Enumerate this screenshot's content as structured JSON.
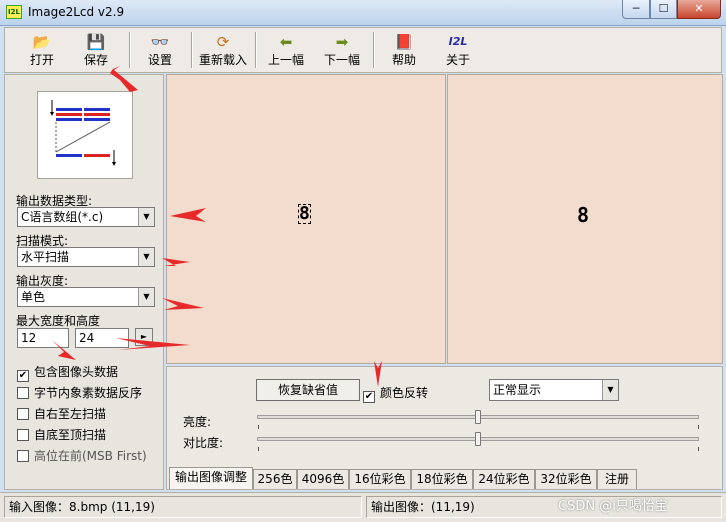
{
  "window": {
    "title": "Image2Lcd v2.9",
    "app_icon_text": "I2L",
    "minimize": "─",
    "maximize": "☐",
    "close": "✕"
  },
  "toolbar": {
    "buttons": [
      {
        "label": "打开",
        "icon": "open-folder-icon",
        "glyph": "📂"
      },
      {
        "label": "保存",
        "icon": "floppy-save-icon",
        "glyph": "💾"
      },
      {
        "label": "设置",
        "icon": "glasses-settings-icon",
        "glyph": "👓"
      },
      {
        "label": "重新载入",
        "icon": "reload-icon",
        "glyph": "⟳"
      },
      {
        "label": "上一幅",
        "icon": "arrow-left-icon",
        "glyph": "⬅"
      },
      {
        "label": "下一幅",
        "icon": "arrow-right-icon",
        "glyph": "➡"
      },
      {
        "label": "帮助",
        "icon": "help-book-icon",
        "glyph": "📕"
      },
      {
        "label": "关于",
        "icon": "about-i2l-icon",
        "glyph": "I2L"
      }
    ]
  },
  "left_panel": {
    "output_type": {
      "label": "输出数据类型:",
      "value": "C语言数组(*.c)"
    },
    "scan_mode": {
      "label": "扫描模式:",
      "value": "水平扫描"
    },
    "output_gray": {
      "label": "输出灰度:",
      "value": "单色"
    },
    "max_size": {
      "label": "最大宽度和高度",
      "width": "12",
      "height": "24"
    },
    "options": [
      {
        "label": "包含图像头数据",
        "checked": true
      },
      {
        "label": "字节内象素数据反序",
        "checked": false
      },
      {
        "label": "自右至左扫描",
        "checked": false
      },
      {
        "label": "自底至顶扫描",
        "checked": false
      },
      {
        "label": "高位在前(MSB First)",
        "checked": false
      }
    ]
  },
  "preview": {
    "input_glyph": "8",
    "output_glyph": "8"
  },
  "adjust": {
    "restore_button": "恢复缺省值",
    "invert_color": {
      "label": "颜色反转",
      "checked": true
    },
    "display_mode": "正常显示",
    "brightness": {
      "label": "亮度:",
      "level": 0.5
    },
    "contrast": {
      "label": "对比度:",
      "level": 0.5
    },
    "tabs": [
      "输出图像调整",
      "256色",
      "4096色",
      "16位彩色",
      "18位彩色",
      "24位彩色",
      "32位彩色",
      "注册"
    ]
  },
  "status": {
    "input": "输入图像：8.bmp (11,19)",
    "output": "输出图像：(11,19)",
    "watermark": "CSDN @i只喝怡宝"
  },
  "colors": {
    "annotation_arrow": "#e8292a",
    "preview_bg": "#f2dccd"
  }
}
